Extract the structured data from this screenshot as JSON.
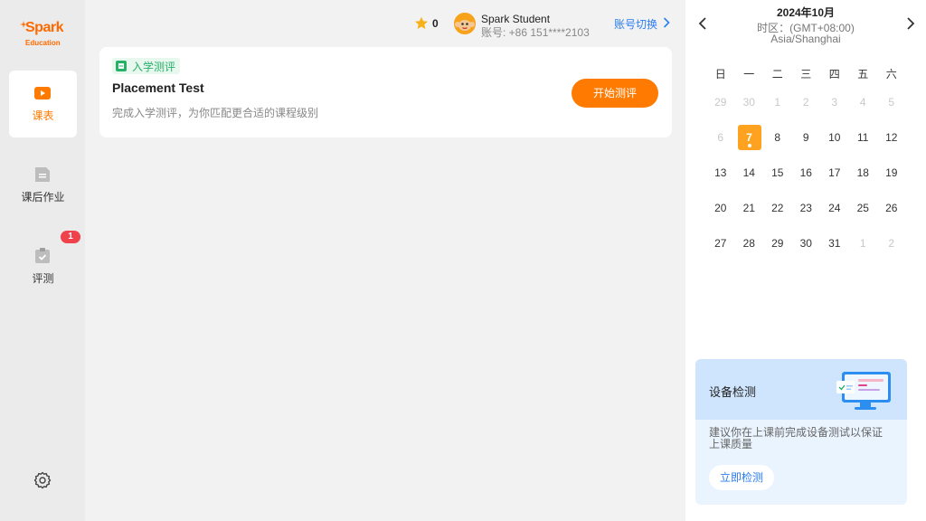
{
  "sidebar": {
    "logo": {
      "brand": "Spark",
      "sub": "Education"
    },
    "items": [
      {
        "label": "课表",
        "icon": "play-icon",
        "active": true
      },
      {
        "label": "课后作业",
        "icon": "document-icon",
        "active": false
      },
      {
        "label": "评测",
        "icon": "clipboard-check-icon",
        "active": false,
        "badge": "1"
      }
    ],
    "settings_icon": "gear-icon"
  },
  "header": {
    "star_count": "0",
    "user_name": "Spark Student",
    "account": "账号: +86 151****2103",
    "switch_label": "账号切换"
  },
  "card": {
    "tag": "入学测评",
    "title": "Placement Test",
    "description": "完成入学测评，为你匹配更合适的课程级别",
    "button": "开始测评"
  },
  "calendar": {
    "month": "2024年10月",
    "timezone_line1": "时区：(GMT+08:00)",
    "timezone_line2": "Asia/Shanghai",
    "weekdays": [
      "日",
      "一",
      "二",
      "三",
      "四",
      "五",
      "六"
    ],
    "days": [
      {
        "d": "29",
        "muted": true
      },
      {
        "d": "30",
        "muted": true
      },
      {
        "d": "1",
        "muted": true
      },
      {
        "d": "2",
        "muted": true
      },
      {
        "d": "3",
        "muted": true
      },
      {
        "d": "4",
        "muted": true
      },
      {
        "d": "5",
        "muted": true
      },
      {
        "d": "6",
        "muted": true
      },
      {
        "d": "7",
        "today": true
      },
      {
        "d": "8"
      },
      {
        "d": "9"
      },
      {
        "d": "10"
      },
      {
        "d": "11"
      },
      {
        "d": "12"
      },
      {
        "d": "13"
      },
      {
        "d": "14"
      },
      {
        "d": "15"
      },
      {
        "d": "16"
      },
      {
        "d": "17"
      },
      {
        "d": "18"
      },
      {
        "d": "19"
      },
      {
        "d": "20"
      },
      {
        "d": "21"
      },
      {
        "d": "22"
      },
      {
        "d": "23"
      },
      {
        "d": "24"
      },
      {
        "d": "25"
      },
      {
        "d": "26"
      },
      {
        "d": "27"
      },
      {
        "d": "28"
      },
      {
        "d": "29"
      },
      {
        "d": "30"
      },
      {
        "d": "31"
      },
      {
        "d": "1",
        "muted": true
      },
      {
        "d": "2",
        "muted": true
      }
    ]
  },
  "device_check": {
    "title": "设备检测",
    "description": "建议你在上课前完成设备测试以保证上课质量",
    "button": "立即检测"
  },
  "colors": {
    "accent_orange": "#ff7a00",
    "today_orange": "#ffa21f",
    "link_blue": "#2b7df2",
    "tag_green": "#27b068",
    "badge_red": "#f0424b"
  }
}
